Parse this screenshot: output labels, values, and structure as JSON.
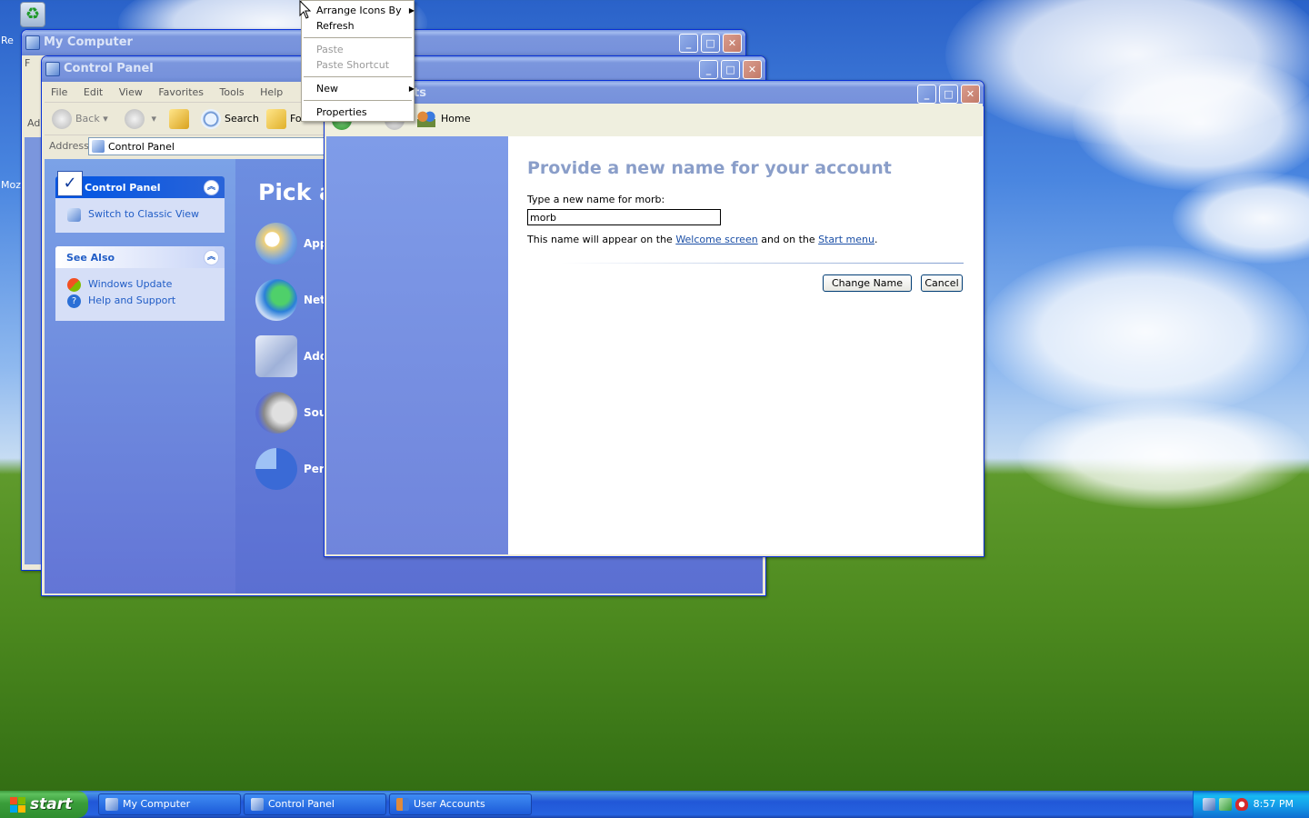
{
  "desktop": {
    "recycle_label": "Re",
    "side_label": "Moz"
  },
  "my_computer": {
    "title": "My Computer",
    "menu_fragment": "F",
    "address_fragment": "Ad"
  },
  "control_panel": {
    "title": "Control Panel",
    "menu": [
      "File",
      "Edit",
      "View",
      "Favorites",
      "Tools",
      "Help"
    ],
    "toolbar": {
      "back": "Back",
      "search": "Search",
      "folders": "Fo"
    },
    "address_label": "Address",
    "address_value": "Control Panel",
    "task_panel": {
      "title": "Control Panel",
      "switch_view": "Switch to Classic View"
    },
    "see_also": {
      "title": "See Also",
      "items": [
        "Windows Update",
        "Help and Support"
      ]
    },
    "heading": "Pick a",
    "categories": [
      "App",
      "Netw",
      "Add",
      "Sou",
      "Perf"
    ]
  },
  "context_menu": {
    "items": [
      {
        "label": "Arrange Icons By",
        "submenu": true,
        "enabled": true
      },
      {
        "label": "Refresh",
        "submenu": false,
        "enabled": true
      },
      {
        "label": "Paste",
        "submenu": false,
        "enabled": false
      },
      {
        "label": "Paste Shortcut",
        "submenu": false,
        "enabled": false
      },
      {
        "label": "New",
        "submenu": true,
        "enabled": true
      },
      {
        "label": "Properties",
        "submenu": false,
        "enabled": true
      }
    ]
  },
  "user_accounts": {
    "title_fragment": "ts",
    "nav_home": "Home",
    "heading": "Provide a new name for your account",
    "prompt": "Type a new name for morb:",
    "input_value": "morb",
    "note_prefix": "This name will appear on the ",
    "note_link1": "Welcome screen",
    "note_middle": " and on the ",
    "note_link2": "Start menu",
    "note_suffix": ".",
    "change_button": "Change Name",
    "cancel_button": "Cancel"
  },
  "taskbar": {
    "start_label": "start",
    "tasks": [
      "My Computer",
      "Control Panel",
      "User Accounts"
    ],
    "clock": "8:57 PM"
  },
  "colors": {
    "xp_blue": "#0a5fe4",
    "task_pane": "#6375d6",
    "heading_gray_blue": "#8a9ec9",
    "start_green": "#3a9d3a"
  }
}
